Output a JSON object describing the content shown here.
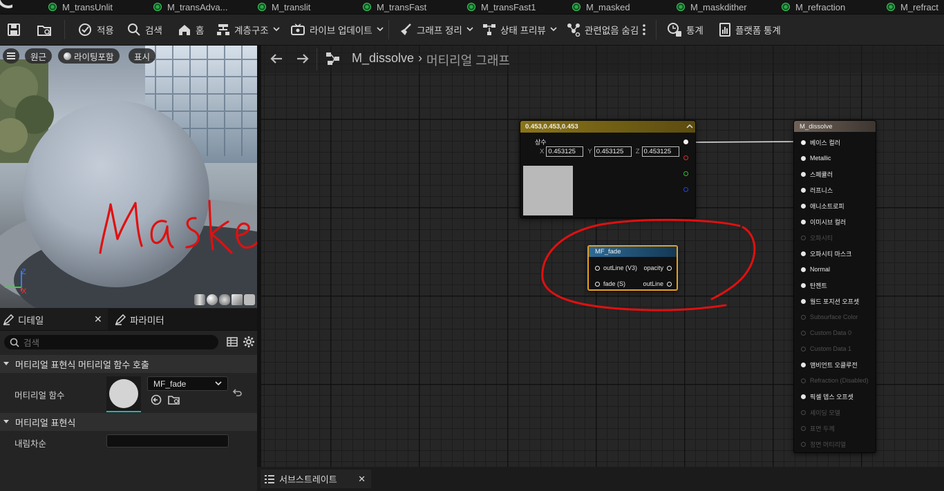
{
  "tabs": [
    {
      "label": "M_transUnlit"
    },
    {
      "label": "M_transAdva..."
    },
    {
      "label": "M_translit"
    },
    {
      "label": "M_transFast"
    },
    {
      "label": "M_transFast1"
    },
    {
      "label": "M_masked"
    },
    {
      "label": "M_maskdither"
    },
    {
      "label": "M_refraction"
    },
    {
      "label": "M_refract"
    }
  ],
  "toolbar": {
    "apply": "적용",
    "search": "검색",
    "home": "홈",
    "hierarchy": "계층구조",
    "live_update": "라이브 업데이트",
    "graph_cleanup": "그래프 정리",
    "state_preview": "상태 프리뷰",
    "hide_unrelated": "관련없음 숨김",
    "stats": "통계",
    "platform_stats": "플랫폼 통계"
  },
  "viewport": {
    "perspective": "원근",
    "lighting": "라이팅포함",
    "show": "표시",
    "axis_z": "Z",
    "axis_x": "X",
    "annotation": "Masked"
  },
  "details": {
    "tab_details": "디테일",
    "tab_params": "파라미터",
    "search_placeholder": "검색",
    "section_call": "머티리얼 표현식 머티리얼 함수 호출",
    "material_function_label": "머티리얼 함수",
    "material_function_value": "MF_fade",
    "section_expression": "머티리얼 표현식",
    "sort_priority_label": "내림차순",
    "sort_priority_value": ""
  },
  "breadcrumb": {
    "asset": "M_dissolve",
    "separator": "›",
    "graph": "머티리얼 그래프"
  },
  "constant_node": {
    "title": "0.453,0.453,0.453",
    "label": "상수",
    "x_label": "X",
    "x_value": "0.453125",
    "y_label": "Y",
    "y_value": "0.453125",
    "z_label": "Z",
    "z_value": "0.453125",
    "preview_color": "#b9b9b9"
  },
  "fade_node": {
    "title": "MF_fade",
    "in1": "outLine (V3)",
    "in2": "fade (S)",
    "out1": "opacity",
    "out2": "outLine"
  },
  "result_node": {
    "title": "M_dissolve",
    "pins": [
      {
        "label": "베이스 컬러",
        "active": true
      },
      {
        "label": "Metallic",
        "active": true
      },
      {
        "label": "스페큘러",
        "active": true
      },
      {
        "label": "러프니스",
        "active": true
      },
      {
        "label": "애니소트로피",
        "active": true
      },
      {
        "label": "이미시브 컬러",
        "active": true
      },
      {
        "label": "오파시티",
        "active": false
      },
      {
        "label": "오파시티 마스크",
        "active": true
      },
      {
        "label": "Normal",
        "active": true
      },
      {
        "label": "탄젠트",
        "active": true
      },
      {
        "label": "월드 포지션 오프셋",
        "active": true
      },
      {
        "label": "Subsurface Color",
        "active": false
      },
      {
        "label": "Custom Data 0",
        "active": false
      },
      {
        "label": "Custom Data 1",
        "active": false
      },
      {
        "label": "앰비언트 오클루전",
        "active": true
      },
      {
        "label": "Refraction (Disabled)",
        "active": false
      },
      {
        "label": "픽셀 뎁스 오프셋",
        "active": true
      },
      {
        "label": "셰이딩 모델",
        "active": false
      },
      {
        "label": "표면 두께",
        "active": false
      },
      {
        "label": "정면 머티리얼",
        "active": false
      }
    ]
  },
  "bottom": {
    "substrate_tab": "서브스트레이트"
  },
  "colors": {
    "accent_green": "#2aa84a",
    "selection_orange": "#e8a020",
    "annotation_red": "#e01010"
  }
}
